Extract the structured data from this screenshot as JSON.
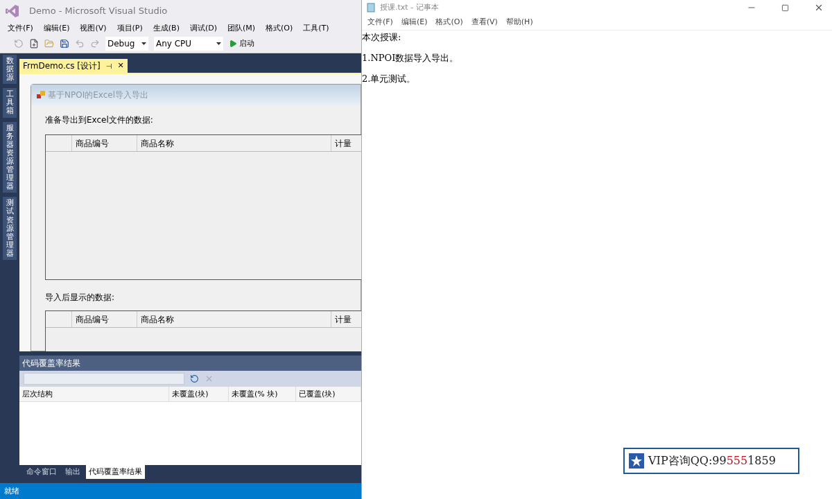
{
  "vs": {
    "title": "Demo - Microsoft Visual Studio",
    "menu": [
      "文件(F)",
      "编辑(E)",
      "视图(V)",
      "项目(P)",
      "生成(B)",
      "调试(D)",
      "团队(M)",
      "格式(O)",
      "工具(T)"
    ],
    "toolbar": {
      "config": "Debug",
      "platform": "Any CPU",
      "start": "启动"
    },
    "side_tabs": [
      "数据源",
      "工具箱",
      "服务器资源管理器",
      "测试资源管理器"
    ],
    "doc_tab": {
      "label": "FrmDemo.cs [设计]",
      "pin": "⊣",
      "close": "✕"
    },
    "form": {
      "title": "基于NPOI的Excel导入导出",
      "sections": [
        {
          "label": "准备导出到Excel文件的数据:",
          "columns": [
            "商品编号",
            "商品名称",
            "计量"
          ]
        },
        {
          "label": "导入后显示的数据:",
          "columns": [
            "商品编号",
            "商品名称",
            "计量"
          ]
        }
      ]
    },
    "coverage": {
      "title": "代码覆盖率结果",
      "columns": [
        "层次结构",
        "未覆盖(块)",
        "未覆盖(% 块)",
        "已覆盖(块)"
      ]
    },
    "bottom_tabs": [
      {
        "label": "命令窗口",
        "selected": false
      },
      {
        "label": "输出",
        "selected": false
      },
      {
        "label": "代码覆盖率结果",
        "selected": true
      }
    ],
    "status": "就绪"
  },
  "notepad": {
    "title": "授课.txt - 记事本",
    "menu": [
      "文件(F)",
      "编辑(E)",
      "格式(O)",
      "查看(V)",
      "帮助(H)"
    ],
    "lines": [
      "本次授课:",
      "1.NPOI数据导入导出。",
      "2.单元测试。"
    ]
  },
  "overlay": {
    "parts": [
      {
        "text": "VIP咨询QQ:99",
        "highlight": false
      },
      {
        "text": "555",
        "highlight": true
      },
      {
        "text": "1859",
        "highlight": false
      }
    ]
  }
}
